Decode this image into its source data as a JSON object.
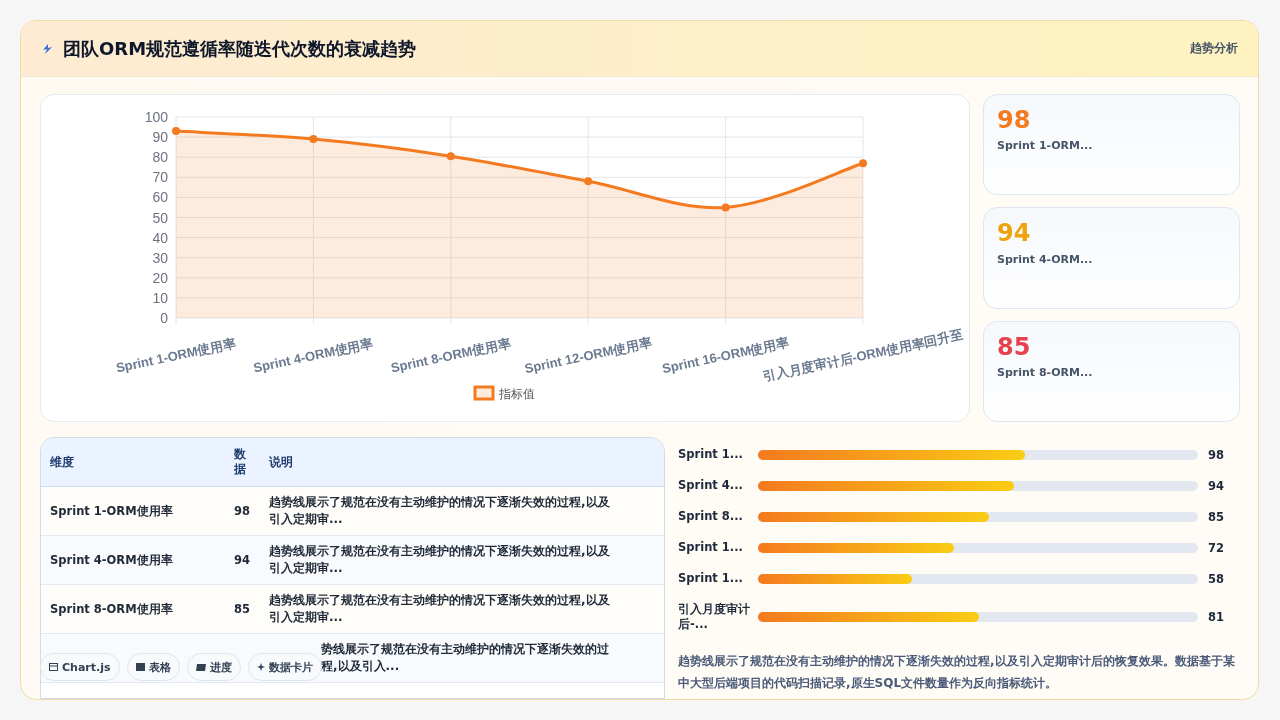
{
  "header": {
    "title": "团队ORM规范遵循率随迭代次数的衰减趋势",
    "tag": "趋势分析"
  },
  "chart": {
    "chart_data": {
      "type": "area",
      "categories": [
        "Sprint 1-ORM使用率",
        "Sprint 4-ORM使用率",
        "Sprint 8-ORM使用率",
        "Sprint 12-ORM使用率",
        "Sprint 16-ORM使用率",
        "引入月度审计后-ORM使用率回升至"
      ],
      "series": [
        {
          "name": "指标值",
          "color": "#f47a1f",
          "values": [
            93,
            89,
            80.5,
            68,
            55,
            77
          ]
        }
      ],
      "ylim": [
        0,
        100
      ],
      "grid": true,
      "yticks": [
        0,
        10,
        20,
        30,
        40,
        50,
        60,
        70,
        80,
        90,
        100
      ]
    }
  },
  "stat_cards": [
    {
      "value": "98",
      "label": "Sprint 1-ORM...",
      "color": "#f47a1f"
    },
    {
      "value": "94",
      "label": "Sprint 4-ORM...",
      "color": "#eea20c"
    },
    {
      "value": "85",
      "label": "Sprint 8-ORM...",
      "color": "#e5424d"
    }
  ],
  "table": {
    "columns": [
      "维度",
      "数据",
      "说明"
    ],
    "rows": [
      {
        "dimension": "Sprint 1-ORM使用率",
        "value": "98",
        "note": "趋势线展示了规范在没有主动维护的情况下逐渐失效的过程,以及引入定期审..."
      },
      {
        "dimension": "Sprint 4-ORM使用率",
        "value": "94",
        "note": "趋势线展示了规范在没有主动维护的情况下逐渐失效的过程,以及引入定期审..."
      },
      {
        "dimension": "Sprint 8-ORM使用率",
        "value": "85",
        "note": "趋势线展示了规范在没有主动维护的情况下逐渐失效的过程,以及引入定期审..."
      },
      {
        "note": "势线展示了规范在没有主动维护的情况下逐渐失效的过程,以及引入..."
      }
    ]
  },
  "progress": [
    {
      "label": "Sprint 1...",
      "level": 0.607,
      "value": "98"
    },
    {
      "label": "Sprint 4...",
      "level": 0.582,
      "value": "94"
    },
    {
      "label": "Sprint 8...",
      "level": 0.525,
      "value": "85"
    },
    {
      "label": "Sprint 1...",
      "level": 0.445,
      "value": "72"
    },
    {
      "label": "Sprint 1...",
      "level": 0.35,
      "value": "58"
    },
    {
      "label": "引入月度审计后-...",
      "level": 0.503,
      "value": "81"
    }
  ],
  "note": "趋势线展示了规范在没有主动维护的情况下逐渐失效的过程,以及引入定期审计后的恢复效果。数据基于某中大型后端项目的代码扫描记录,原生SQL文件数量作为反向指标统计。",
  "chips": [
    {
      "kind": "chart",
      "label": "Chart.js"
    },
    {
      "kind": "table",
      "label": "表格"
    },
    {
      "kind": "progress",
      "label": "进度"
    },
    {
      "kind": "cards",
      "label": "数据卡片"
    }
  ]
}
